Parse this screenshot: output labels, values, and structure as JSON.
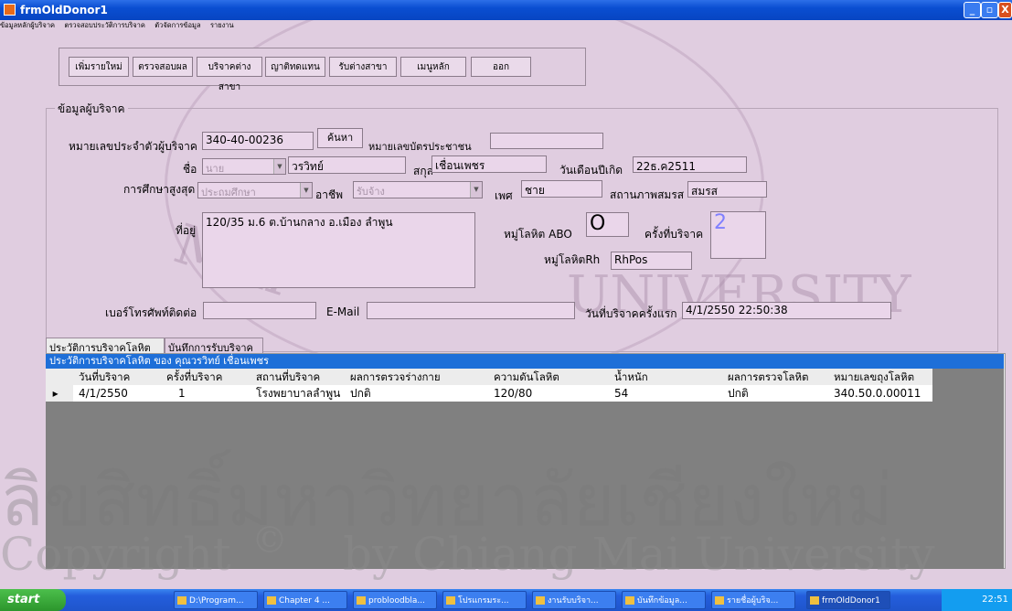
{
  "window": {
    "title": "frmOldDonor1",
    "controls": [
      "_",
      "▫",
      "X"
    ]
  },
  "menu": [
    "ข้อมูลหลักผู้บริจาค",
    "ตรวจสอบประวัติการบริจาค",
    "ตัวจัดการข้อมูล",
    "รายงาน"
  ],
  "toolbar": [
    "เพิ่มรายใหม่",
    "ตรวจสอบผล",
    "บริจาคต่างสาขา",
    "ญาติทดแทน",
    "รับต่างสาขา",
    "เมนูหลัก",
    "ออก"
  ],
  "donor_group": {
    "title": "ข้อมูลผู้บริจาค",
    "donor_id_label": "หมายเลขประจำตัวผู้บริจาค",
    "donor_id": "340-40-00236",
    "search_button": "ค้นหา",
    "citizen_id_label": "หมายเลขบัตรประชาชน",
    "citizen_id": "",
    "name_label": "ชื่อ",
    "prefix": "นาย",
    "first_name": "วรวิทย์",
    "surname_label": "สกุล",
    "surname": "เชื่อนเพชร",
    "birthdate_label": "วันเดือนปีเกิด",
    "birthdate": "22ธ.ค2511",
    "education_label": "การศึกษาสูงสุด",
    "education": "ประถมศึกษา",
    "occupation_label": "อาชีพ",
    "occupation": "รับจ้าง",
    "sex_label": "เพศ",
    "sex": "ชาย",
    "marital_label": "สถานภาพสมรส",
    "marital": "สมรส",
    "address_label": "ที่อยู่",
    "address": "120/35 ม.6 ต.บ้านกลาง อ.เมือง ลำพูน",
    "abo_label": "หมู่โลหิต ABO",
    "abo": "O",
    "donation_count_label": "ครั้งที่บริจาค",
    "donation_count": "2",
    "rh_label": "หมู่โลหิตRh",
    "rh": "RhPos",
    "phone_label": "เบอร์โทรศัพท์ติดต่อ",
    "phone": "",
    "email_label": "E-Mail",
    "email": "",
    "first_donation_label": "วันที่บริจาคครั้งแรก",
    "first_donation": "4/1/2550 22:50:38"
  },
  "tabs": [
    "ประวัติการบริจาคโลหิต",
    "บันทึกการรับบริจาค"
  ],
  "grid": {
    "title": "ประวัติการบริจาคโลหิต ของ คุณวรวิทย์  เชื่อนเพชร",
    "columns": [
      "วันที่บริจาค",
      "ครั้งที่บริจาค",
      "สถานที่บริจาค",
      "ผลการตรวจร่างกาย",
      "ความดันโลหิต",
      "น้ำหนัก",
      "ผลการตรวจโลหิต",
      "หมายเลขถุงโลหิต"
    ],
    "rows": [
      [
        "4/1/2550",
        "1",
        "โรงพยาบาลลำพูน",
        "ปกติ",
        "120/80",
        "54",
        "ปกติ",
        "340.50.0.00011"
      ]
    ]
  },
  "watermark": [
    "MAI",
    "UNIVERSITY",
    "ลิขสิทธิ์มหาวิทยาลัยเชียงใหม่",
    "Copyright",
    "©",
    "by Chiang Mai University"
  ],
  "taskbar": {
    "start": "start",
    "tasks": [
      "D:\\Program...",
      "Chapter 4 ...",
      "probloodbla...",
      "โปรแกรมระ...",
      "งานรับบริจา...",
      "บันทึกข้อมูล...",
      "รายชื่อผู้บริจ...",
      "frmOldDonor1"
    ],
    "clock": "22:51"
  }
}
